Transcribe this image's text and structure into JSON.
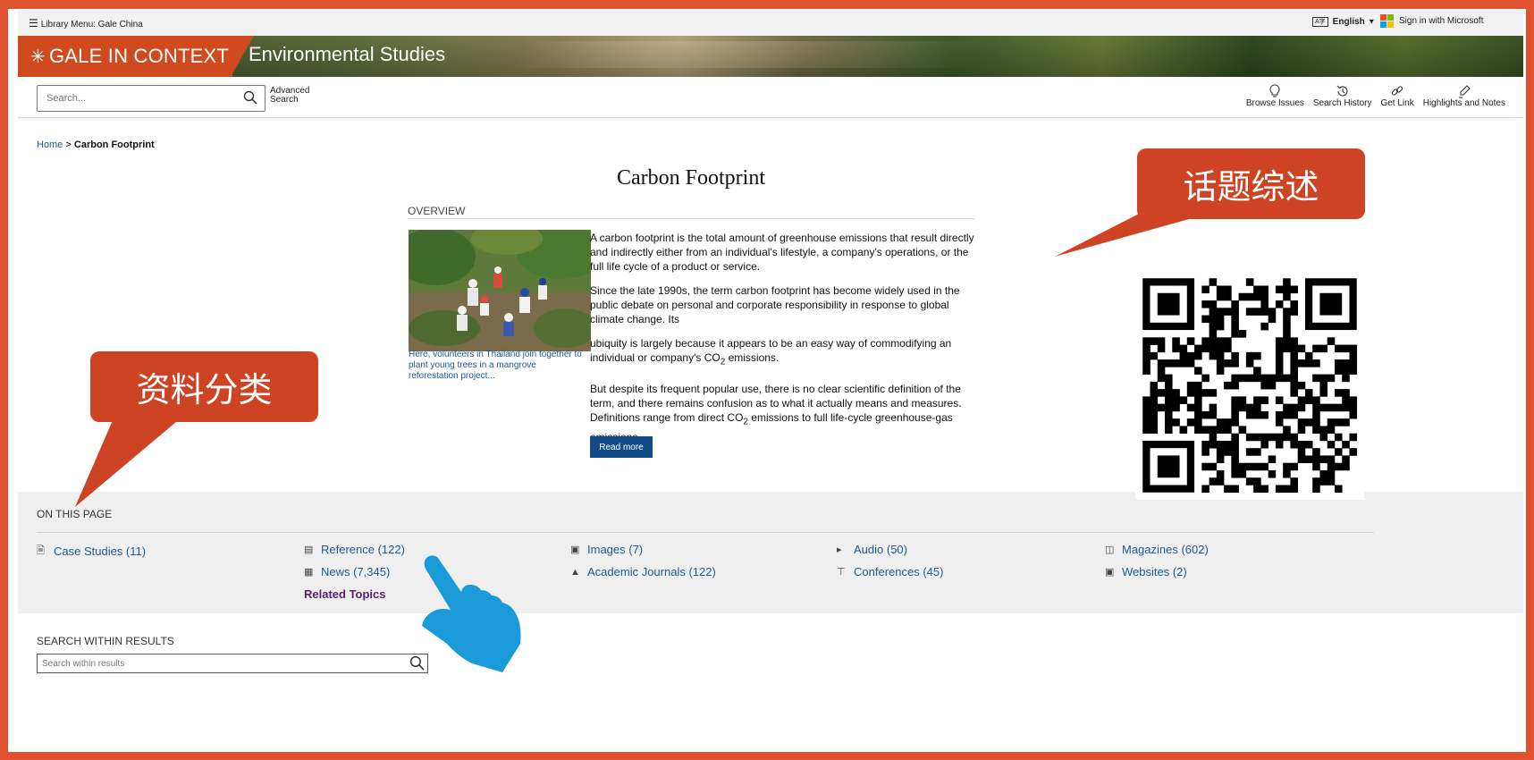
{
  "utilbar": {
    "library_menu": "Library Menu: Gale China",
    "language_icon": "A字",
    "language": "English",
    "sign_in": "Sign in with Microsoft"
  },
  "banner": {
    "brand": "GALE IN CONTEXT",
    "subtitle": "Environmental Studies"
  },
  "search": {
    "placeholder": "Search...",
    "advanced": "Advanced Search"
  },
  "tools": [
    {
      "label": "Browse Issues",
      "icon": "lightbulb-icon"
    },
    {
      "label": "Search History",
      "icon": "history-icon"
    },
    {
      "label": "Get Link",
      "icon": "link-icon"
    },
    {
      "label": "Highlights and Notes",
      "icon": "highlighter-icon"
    }
  ],
  "breadcrumb": {
    "home": "Home",
    "separator": ">",
    "current": "Carbon Footprint"
  },
  "page_title": "Carbon Footprint",
  "overview": {
    "label": "OVERVIEW",
    "caption": "Here, volunteers in Thailand join together to plant young trees in a mangrove reforestation project...",
    "p1": "A carbon footprint is the total amount of greenhouse emissions that result directly and indirectly either from an individual's lifestyle, a company's operations, or the full life cycle of a product or service.",
    "p2": "Since the late 1990s, the term carbon footprint has become widely used in the public debate on personal and corporate responsibility in response to global climate change. Its",
    "p3_pre": "ubiquity is largely because it appears to be an easy way of commodifying an individual or company's CO",
    "p3_sub": "2",
    "p3_post": " emissions.",
    "p4_pre": "But despite its frequent popular use, there is no clear scientific definition of the term, and there remains confusion as to what it actually means and measures. Definitions range from direct CO",
    "p4_sub": "2",
    "p4_post": " emissions to full life-cycle greenhouse-gas emissions....",
    "read_more": "Read more"
  },
  "callouts": {
    "topic_overview": "话题综述",
    "categories": "资料分类"
  },
  "on_this_page": {
    "label": "ON THIS PAGE",
    "items": [
      {
        "label": "Case Studies (11)",
        "icon": "document-icon"
      },
      {
        "label": "Reference (122)",
        "icon": "book-icon"
      },
      {
        "label": "News (7,345)",
        "icon": "newspaper-icon"
      },
      {
        "label": "Images (7)",
        "icon": "image-icon"
      },
      {
        "label": "Academic Journals (122)",
        "icon": "graduation-cap-icon"
      },
      {
        "label": "Audio (50)",
        "icon": "speaker-icon"
      },
      {
        "label": "Conferences (45)",
        "icon": "podium-icon"
      },
      {
        "label": "Magazines (602)",
        "icon": "open-book-icon"
      },
      {
        "label": "Websites (2)",
        "icon": "browser-icon"
      }
    ],
    "related_topics": "Related Topics"
  },
  "search_within": {
    "label": "SEARCH WITHIN RESULTS",
    "placeholder": "Search within results"
  },
  "colors": {
    "brand": "#cf4a1e",
    "callout": "#cd4323",
    "link": "#1a5a99",
    "button": "#124b85",
    "frame": "#e0512d",
    "hand": "#1a9ad9"
  }
}
